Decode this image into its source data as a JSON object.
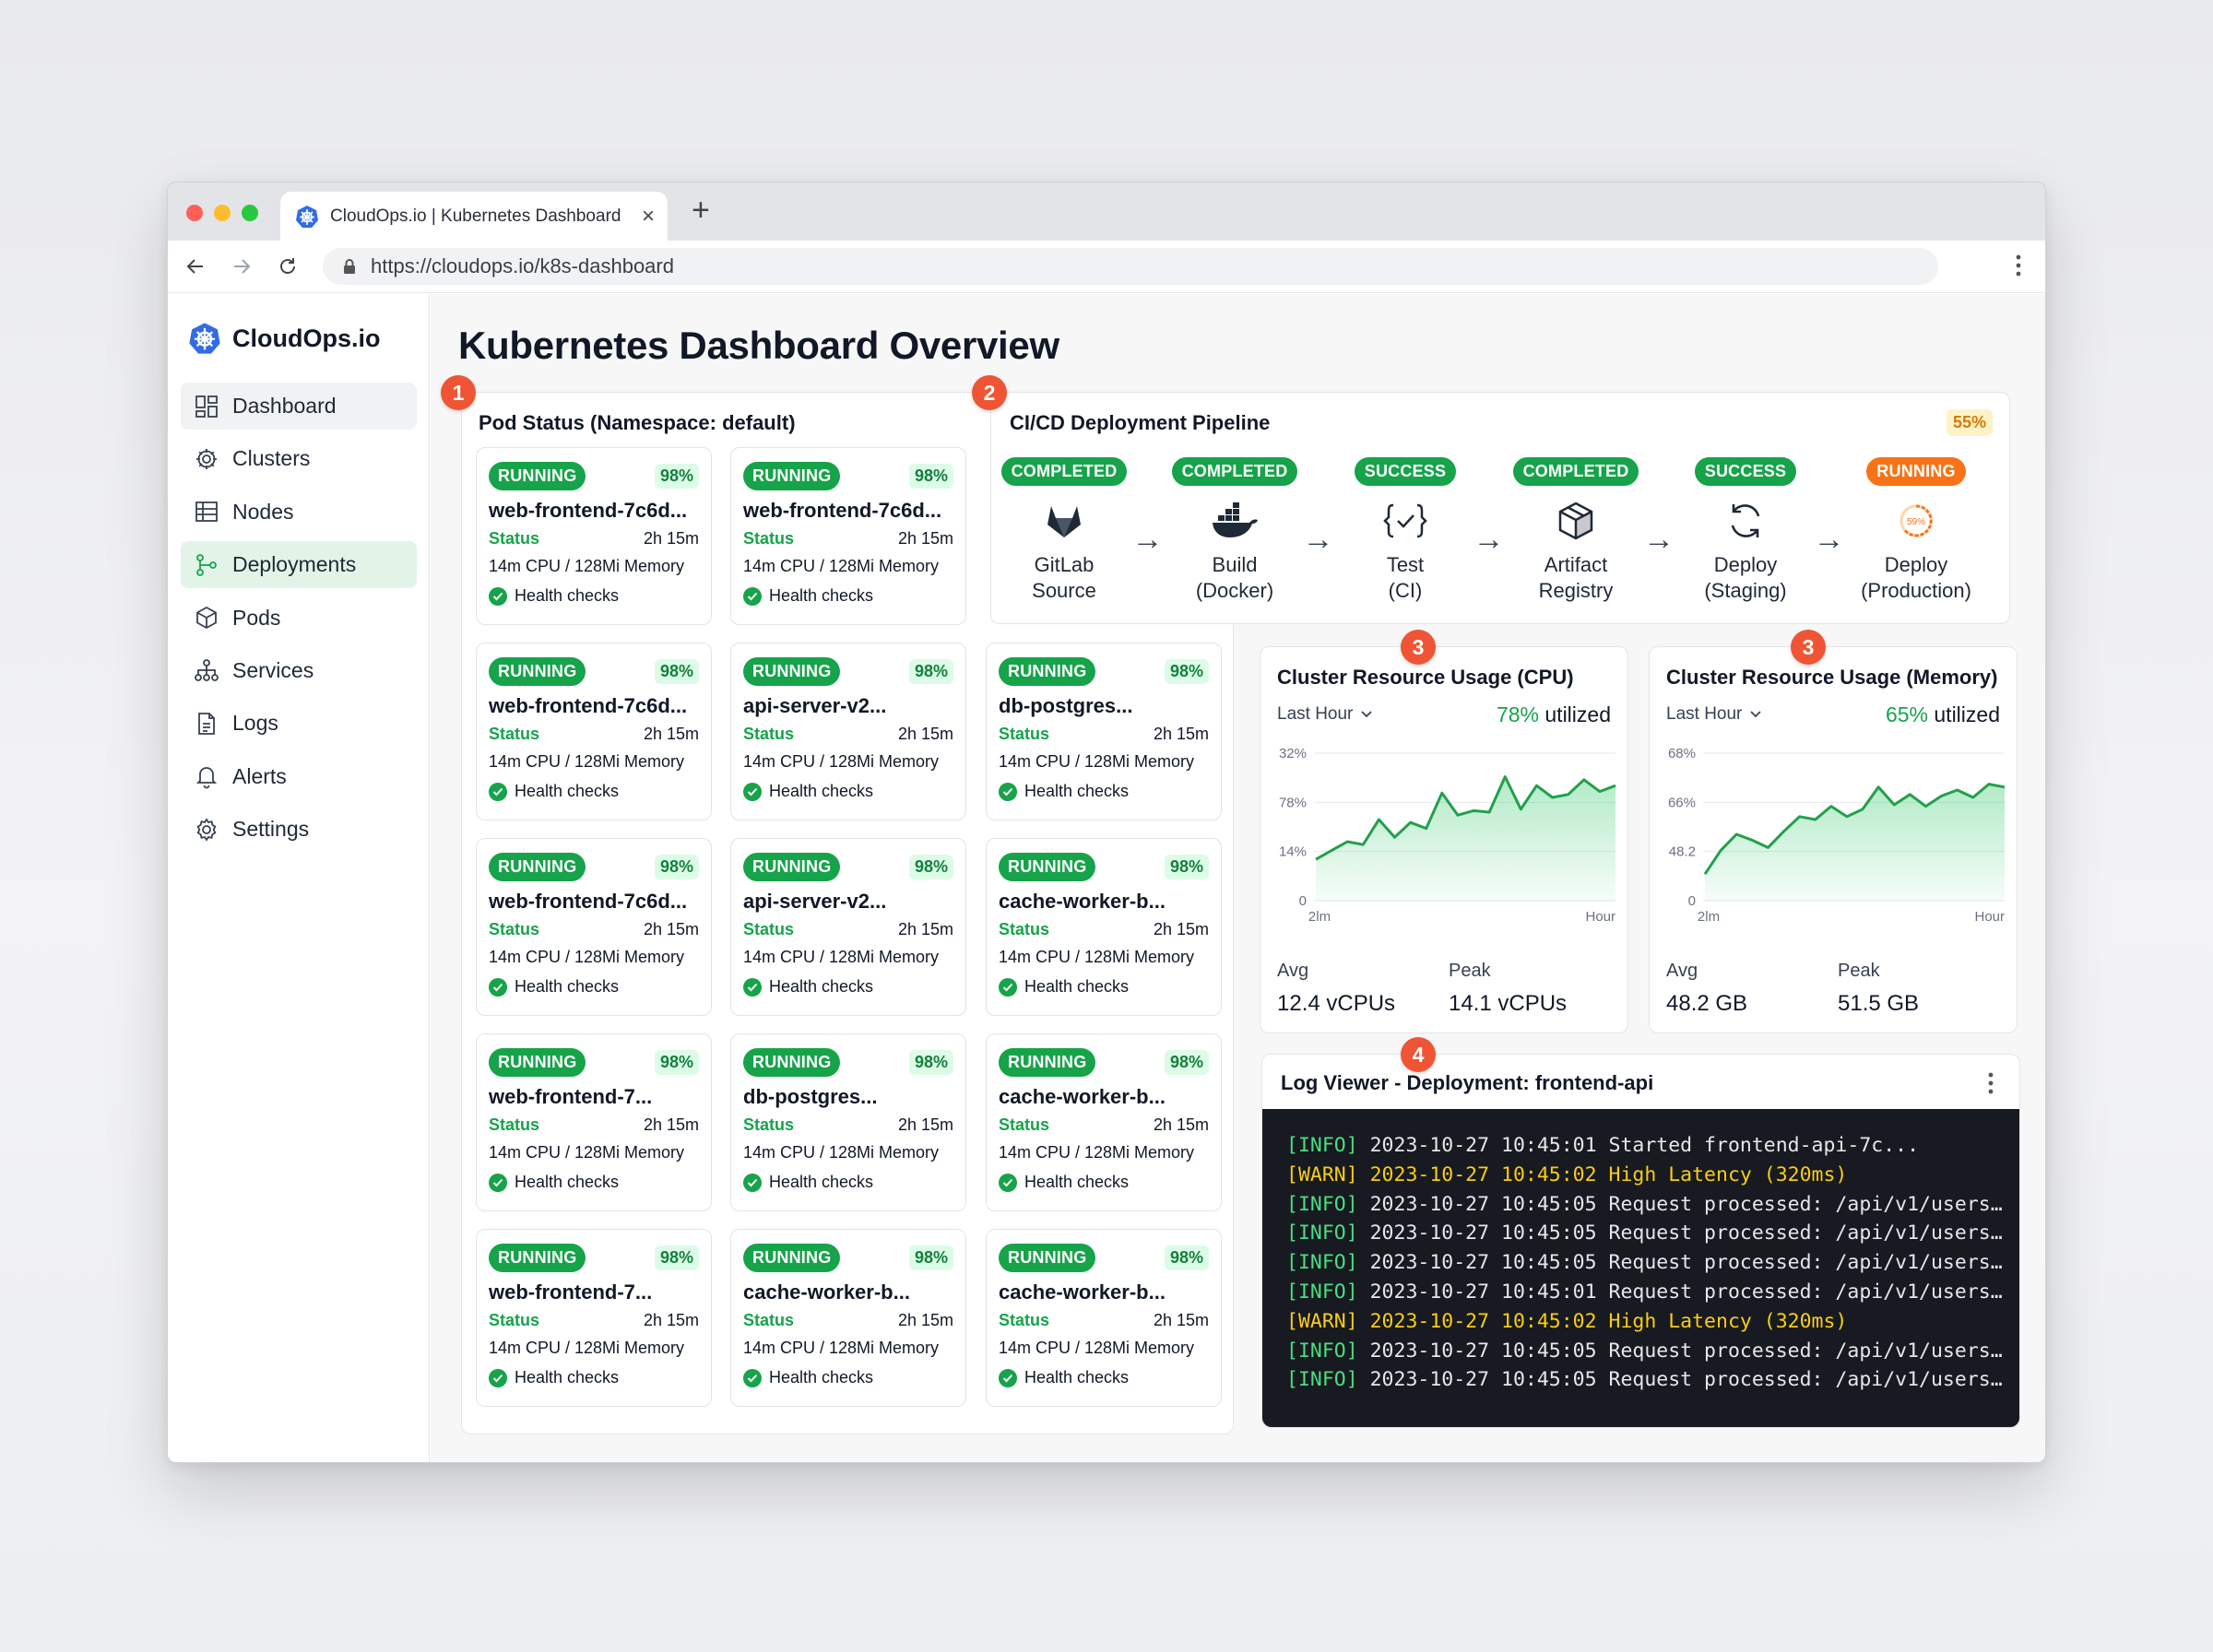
{
  "browser": {
    "tab_title": "CloudOps.io | Kubernetes Dashboard",
    "url": "https://cloudops.io/k8s-dashboard"
  },
  "sidebar": {
    "brand": "CloudOps.io",
    "items": [
      {
        "label": "Dashboard",
        "icon": "dashboard-icon"
      },
      {
        "label": "Clusters",
        "icon": "clusters-icon"
      },
      {
        "label": "Nodes",
        "icon": "nodes-icon"
      },
      {
        "label": "Deployments",
        "icon": "deployments-icon"
      },
      {
        "label": "Pods",
        "icon": "pods-icon"
      },
      {
        "label": "Services",
        "icon": "services-icon"
      },
      {
        "label": "Logs",
        "icon": "logs-icon"
      },
      {
        "label": "Alerts",
        "icon": "bell-icon"
      },
      {
        "label": "Settings",
        "icon": "gear-icon"
      }
    ]
  },
  "page_title": "Kubernetes Dashboard Overview",
  "markers": [
    "1",
    "2",
    "3",
    "3",
    "4"
  ],
  "pods_panel": {
    "title": "Pod Status (Namespace: default)",
    "pods": [
      {
        "status": "RUNNING",
        "pct": "98%",
        "name": "web-frontend-7c6d...",
        "status_label": "Status",
        "age": "2h 15m",
        "resources": "14m CPU / 128Mi Memory",
        "health": "Health checks"
      },
      {
        "status": "RUNNING",
        "pct": "98%",
        "name": "web-frontend-7c6d...",
        "status_label": "Status",
        "age": "2h 15m",
        "resources": "14m CPU / 128Mi Memory",
        "health": "Health checks"
      },
      {
        "status": "RUNNING",
        "pct": "98%",
        "name": "web-frontend-7c6d...",
        "status_label": "Status",
        "age": "2h 15m",
        "resources": "14m CPU / 128Mi Memory",
        "health": "Health checks"
      },
      {
        "status": "RUNNING",
        "pct": "98%",
        "name": "api-server-v2...",
        "status_label": "Status",
        "age": "2h 15m",
        "resources": "14m CPU / 128Mi Memory",
        "health": "Health checks"
      },
      {
        "status": "RUNNING",
        "pct": "98%",
        "name": "db-postgres...",
        "status_label": "Status",
        "age": "2h 15m",
        "resources": "14m CPU / 128Mi Memory",
        "health": "Health checks"
      },
      {
        "status": "RUNNING",
        "pct": "98%",
        "name": "web-frontend-7c6d...",
        "status_label": "Status",
        "age": "2h 15m",
        "resources": "14m CPU / 128Mi Memory",
        "health": "Health checks"
      },
      {
        "status": "RUNNING",
        "pct": "98%",
        "name": "api-server-v2...",
        "status_label": "Status",
        "age": "2h 15m",
        "resources": "14m CPU / 128Mi Memory",
        "health": "Health checks"
      },
      {
        "status": "RUNNING",
        "pct": "98%",
        "name": "cache-worker-b...",
        "status_label": "Status",
        "age": "2h 15m",
        "resources": "14m CPU / 128Mi Memory",
        "health": "Health checks"
      },
      {
        "status": "RUNNING",
        "pct": "98%",
        "name": "web-frontend-7...",
        "status_label": "Status",
        "age": "2h 15m",
        "resources": "14m CPU / 128Mi Memory",
        "health": "Health checks"
      },
      {
        "status": "RUNNING",
        "pct": "98%",
        "name": "db-postgres...",
        "status_label": "Status",
        "age": "2h 15m",
        "resources": "14m CPU / 128Mi Memory",
        "health": "Health checks"
      },
      {
        "status": "RUNNING",
        "pct": "98%",
        "name": "cache-worker-b...",
        "status_label": "Status",
        "age": "2h 15m",
        "resources": "14m CPU / 128Mi Memory",
        "health": "Health checks"
      },
      {
        "status": "RUNNING",
        "pct": "98%",
        "name": "web-frontend-7...",
        "status_label": "Status",
        "age": "2h 15m",
        "resources": "14m CPU / 128Mi Memory",
        "health": "Health checks"
      },
      {
        "status": "RUNNING",
        "pct": "98%",
        "name": "cache-worker-b...",
        "status_label": "Status",
        "age": "2h 15m",
        "resources": "14m CPU / 128Mi Memory",
        "health": "Health checks"
      },
      {
        "status": "RUNNING",
        "pct": "98%",
        "name": "cache-worker-b...",
        "status_label": "Status",
        "age": "2h 15m",
        "resources": "14m CPU / 128Mi Memory",
        "health": "Health checks"
      }
    ]
  },
  "pipeline": {
    "title": "CI/CD Deployment Pipeline",
    "progress": "55%",
    "arrow": "→",
    "stages": [
      {
        "status": "COMPLETED",
        "label1": "GitLab",
        "label2": "Source",
        "icon": "gitlab-icon"
      },
      {
        "status": "COMPLETED",
        "label1": "Build",
        "label2": "(Docker)",
        "icon": "docker-icon"
      },
      {
        "status": "SUCCESS",
        "label1": "Test",
        "label2": "(CI)",
        "icon": "test-braces-icon"
      },
      {
        "status": "COMPLETED",
        "label1": "Artifact",
        "label2": "Registry",
        "icon": "package-icon"
      },
      {
        "status": "SUCCESS",
        "label1": "Deploy",
        "label2": "(Staging)",
        "icon": "sync-icon"
      },
      {
        "status": "RUNNING",
        "label1": "Deploy",
        "label2": "(Production)",
        "icon": "progress-ring-icon",
        "ring_text": "59%"
      }
    ],
    "colors": {
      "done": "#16a34a",
      "running": "#f97316"
    }
  },
  "cpu_panel": {
    "title": "Cluster Resource Usage (CPU)",
    "range": "Last Hour",
    "util_value": "78%",
    "util_suffix": "utilized",
    "avg_label": "Avg",
    "avg_value": "12.4 vCPUs",
    "peak_label": "Peak",
    "peak_value": "14.1 vCPUs"
  },
  "mem_panel": {
    "title": "Cluster Resource Usage (Memory)",
    "range": "Last Hour",
    "util_value": "65%",
    "util_suffix": "utilized",
    "avg_label": "Avg",
    "avg_value": "48.2 GB",
    "peak_label": "Peak",
    "peak_value": "51.5 GB"
  },
  "chart_data": [
    {
      "type": "area",
      "title": "Cluster Resource Usage (CPU)",
      "y_tick_labels": [
        "32%",
        "78%",
        "14%",
        "0"
      ],
      "x_tick_labels": [
        "2lm",
        "Hour"
      ],
      "series": [
        {
          "values": [
            0.28,
            0.34,
            0.4,
            0.38,
            0.55,
            0.43,
            0.53,
            0.49,
            0.73,
            0.58,
            0.61,
            0.6,
            0.84,
            0.62,
            0.78,
            0.7,
            0.72,
            0.82,
            0.74,
            0.78
          ]
        }
      ],
      "color": "#22a04b"
    },
    {
      "type": "area",
      "title": "Cluster Resource Usage (Memory)",
      "y_tick_labels": [
        "68%",
        "66%",
        "48.2",
        "0"
      ],
      "x_tick_labels": [
        "2lm",
        "Hour"
      ],
      "series": [
        {
          "values": [
            0.18,
            0.34,
            0.45,
            0.41,
            0.36,
            0.47,
            0.57,
            0.55,
            0.64,
            0.57,
            0.62,
            0.77,
            0.65,
            0.72,
            0.64,
            0.71,
            0.75,
            0.7,
            0.79,
            0.77
          ]
        }
      ],
      "color": "#22a04b"
    }
  ],
  "log_panel": {
    "title": "Log Viewer - Deployment: frontend-api",
    "lines": [
      {
        "level": "[INFO]",
        "text": " 2023-10-27 10:45:01 Started frontend-api-7c..."
      },
      {
        "level": "[WARN]",
        "text": " 2023-10-27 10:45:02 High Latency (320ms)"
      },
      {
        "level": "[INFO]",
        "text": " 2023-10-27 10:45:05 Request processed: /api/v1/users…"
      },
      {
        "level": "[INFO]",
        "text": " 2023-10-27 10:45:05 Request processed: /api/v1/users…"
      },
      {
        "level": "[INFO]",
        "text": " 2023-10-27 10:45:05 Request processed: /api/v1/users…"
      },
      {
        "level": "[INFO]",
        "text": " 2023-10-27 10:45:01 Request processed: /api/v1/users…"
      },
      {
        "level": "[WARN]",
        "text": " 2023-10-27 10:45:02 High Latency (320ms)"
      },
      {
        "level": "[INFO]",
        "text": " 2023-10-27 10:45:05 Request processed: /api/v1/users…"
      },
      {
        "level": "[INFO]",
        "text": " 2023-10-27 10:45:05 Request processed: /api/v1/users…"
      }
    ]
  }
}
